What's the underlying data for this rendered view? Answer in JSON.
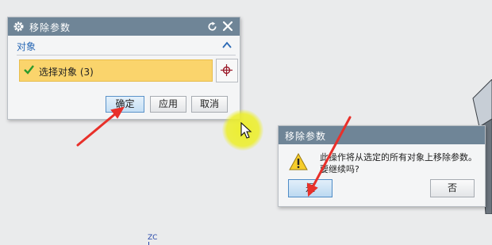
{
  "move_params_dialog": {
    "title": "移除参数",
    "section_label": "对象",
    "selection_label": "选择对象 (3)",
    "ok_label": "确定",
    "apply_label": "应用",
    "cancel_label": "取消"
  },
  "confirm_dialog": {
    "title": "移除参数",
    "message_line1": "此操作将从选定的所有对象上移除参数。",
    "message_line2": "要继续吗?",
    "yes_label": "是",
    "no_label": "否"
  },
  "viewport": {
    "axis_label": "ZC"
  },
  "colors": {
    "titlebar": "#6f8597",
    "selection_highlight": "#fad46c",
    "annotation_arrow": "#e8302a",
    "cursor_highlight": "#ecee28",
    "section_label": "#2a69b5"
  },
  "icons": [
    "gear-icon",
    "reset-icon",
    "close-icon",
    "chevron-up-icon",
    "checkmark-icon",
    "crosshair-icon",
    "warning-icon",
    "mouse-cursor-icon"
  ]
}
